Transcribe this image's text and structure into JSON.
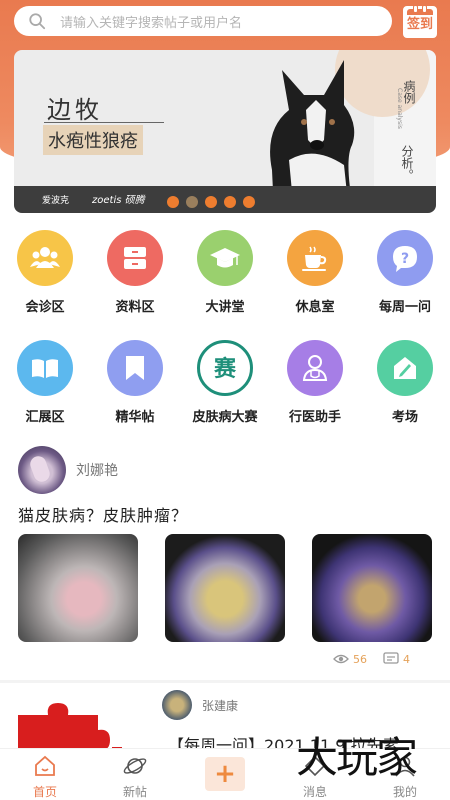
{
  "header": {
    "search_placeholder": "请输入关键字搜索帖子或用户名",
    "checkin_label": "签到",
    "accent": "#e97a4f"
  },
  "banner": {
    "title": "边牧",
    "subtitle": "水疱性狼疮",
    "vertical_text_1": "病例",
    "vertical_text_2": "分析。",
    "tiny_text": "Case analysis",
    "logo_1": "爱波克",
    "logo_2": "zoetis 硕腾",
    "dots": 5,
    "active_dot": 2
  },
  "grid": {
    "items": [
      {
        "label": "会诊区",
        "icon": "group-icon",
        "color": "#f7c548"
      },
      {
        "label": "资料区",
        "icon": "drawer-icon",
        "color": "#ee6a62"
      },
      {
        "label": "大讲堂",
        "icon": "graduation-cap-icon",
        "color": "#9ad06e"
      },
      {
        "label": "休息室",
        "icon": "coffee-cup-icon",
        "color": "#f4a440"
      },
      {
        "label": "每周一问",
        "icon": "question-icon",
        "color": "#8f9cf0"
      },
      {
        "label": "汇展区",
        "icon": "open-book-icon",
        "color": "#5cb8ee"
      },
      {
        "label": "精华帖",
        "icon": "bookmark-icon",
        "color": "#8f9ef0"
      },
      {
        "label": "皮肤病大赛",
        "icon": "competition-icon",
        "color": "#ffffff"
      },
      {
        "label": "行医助手",
        "icon": "doctor-icon",
        "color": "#a67ee6"
      },
      {
        "label": "考场",
        "icon": "exam-icon",
        "color": "#55cfa1"
      }
    ],
    "competition_glyph": "赛"
  },
  "post": {
    "author": "刘娜艳",
    "title": "猫皮肤病？皮肤肿瘤？",
    "views": "56",
    "comments": "4"
  },
  "post2": {
    "author": "张建康",
    "title": "【每周一问】2021.11.9 拉先素"
  },
  "nav": {
    "items": [
      {
        "label": "首页",
        "icon": "home-icon"
      },
      {
        "label": "新帖",
        "icon": "planet-icon"
      },
      {
        "label": "",
        "icon": "plus-icon"
      },
      {
        "label": "消息",
        "icon": "message-icon"
      },
      {
        "label": "我的",
        "icon": "profile-icon"
      }
    ],
    "plus_symbol": "+"
  },
  "watermark": "大玩家"
}
